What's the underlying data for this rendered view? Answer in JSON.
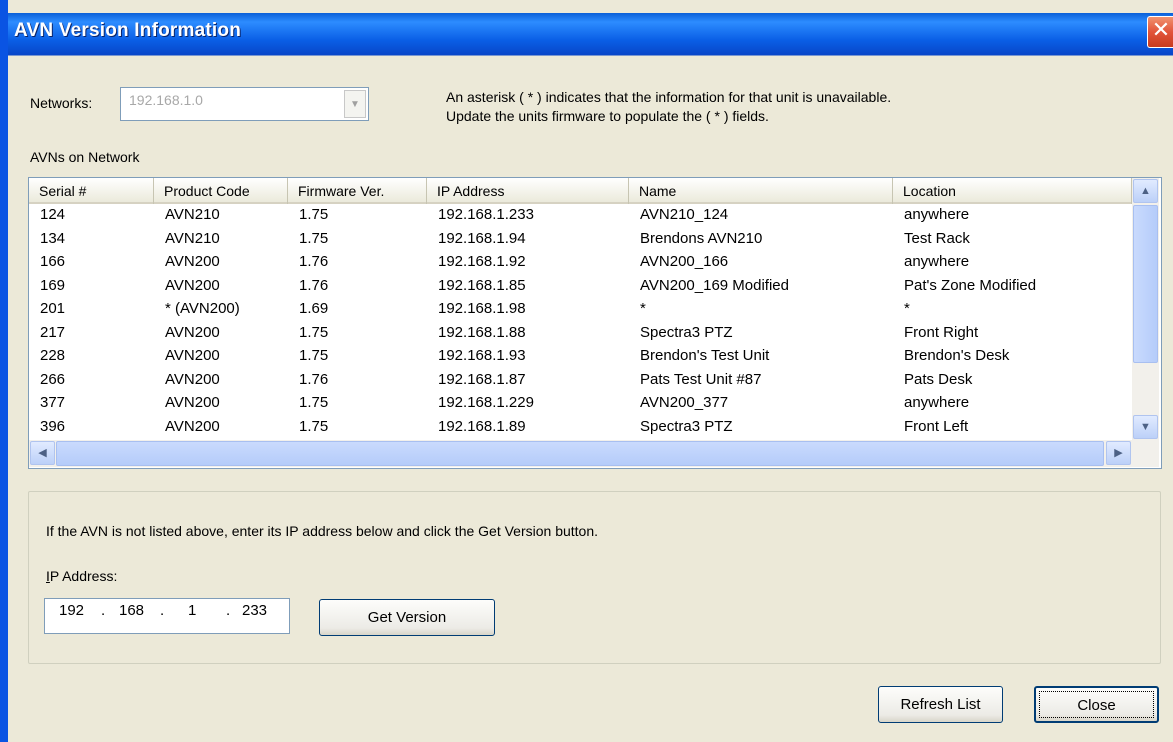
{
  "window": {
    "title": "AVN Version Information",
    "close_glyph": "✕"
  },
  "networks": {
    "label": "Networks:",
    "value": "192.168.1.0"
  },
  "note": {
    "line1": "An asterisk ( * ) indicates that the information for that unit is unavailable.",
    "line2": "Update the units firmware to populate the ( * ) fields."
  },
  "list_label": "AVNs on Network",
  "table": {
    "columns": [
      "Serial #",
      "Product Code",
      "Firmware Ver.",
      "IP Address",
      "Name",
      "Location"
    ],
    "rows": [
      [
        "124",
        "AVN210",
        "1.75",
        "192.168.1.233",
        "AVN210_124",
        "anywhere"
      ],
      [
        "134",
        "AVN210",
        "1.75",
        "192.168.1.94",
        "Brendons  AVN210",
        "Test Rack"
      ],
      [
        "166",
        "AVN200",
        "1.76",
        "192.168.1.92",
        "AVN200_166",
        "anywhere"
      ],
      [
        "169",
        "AVN200",
        "1.76",
        "192.168.1.85",
        "AVN200_169 Modified",
        "Pat's Zone Modified"
      ],
      [
        "201",
        "* (AVN200)",
        "1.69",
        "192.168.1.98",
        "*",
        "*"
      ],
      [
        "217",
        "AVN200",
        "1.75",
        "192.168.1.88",
        "Spectra3 PTZ",
        "Front Right"
      ],
      [
        "228",
        "AVN200",
        "1.75",
        "192.168.1.93",
        "Brendon's Test Unit",
        "Brendon's Desk"
      ],
      [
        "266",
        "AVN200",
        "1.76",
        "192.168.1.87",
        "Pats Test Unit #87",
        "Pats Desk"
      ],
      [
        "377",
        "AVN200",
        "1.75",
        "192.168.1.229",
        "AVN200_377",
        "anywhere"
      ],
      [
        "396",
        "AVN200",
        "1.75",
        "192.168.1.89",
        "Spectra3 PTZ",
        "Front Left"
      ]
    ]
  },
  "manual": {
    "hint": "If the AVN is not listed above, enter its IP address below and click the Get Version button.",
    "ip_label": "IP Address:",
    "ip_octets": [
      "192",
      "168",
      "1",
      "233"
    ],
    "get_version": "Get Version"
  },
  "buttons": {
    "refresh": "Refresh List",
    "close": "Close"
  },
  "icons": {
    "up": "up-arrow-icon",
    "down": "down-arrow-icon",
    "left": "left-arrow-icon",
    "right": "right-arrow-icon",
    "dropdown": "chevron-down-icon"
  }
}
